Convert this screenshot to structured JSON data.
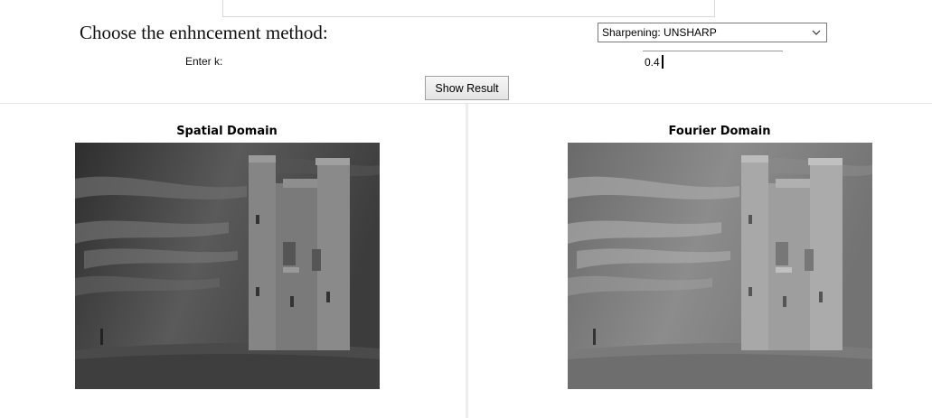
{
  "controls": {
    "method_label": "Choose the enhncement method:",
    "method_selected": "Sharpening: UNSHARP",
    "k_label": "Enter k:",
    "k_value": "0.4",
    "show_result_label": "Show Result"
  },
  "panels": {
    "spatial_title": "Spatial Domain",
    "fourier_title": "Fourier Domain"
  },
  "icons": {
    "select_arrow": "chevron-down-icon"
  },
  "colors": {
    "sky_dark": "#3a3a3a",
    "sky_light": "#9a9a9a",
    "tower": "#8a8a8a",
    "grass": "#505050"
  }
}
